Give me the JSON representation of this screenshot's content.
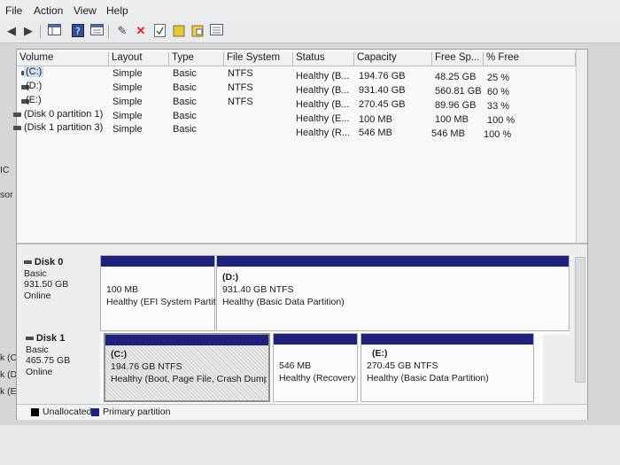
{
  "menu": [
    "File",
    "Action",
    "View",
    "Help"
  ],
  "columns": [
    "Volume",
    "Layout",
    "Type",
    "File System",
    "Status",
    "Capacity",
    "Free Sp...",
    "% Free"
  ],
  "volumes": [
    {
      "volume": "(C:)",
      "layout": "Simple",
      "type": "Basic",
      "fs": "NTFS",
      "status": "Healthy (B...",
      "capacity": "194.76 GB",
      "free": "48.25 GB",
      "pct": "25 %"
    },
    {
      "volume": "(D:)",
      "layout": "Simple",
      "type": "Basic",
      "fs": "NTFS",
      "status": "Healthy (B...",
      "capacity": "931.40 GB",
      "free": "560.81 GB",
      "pct": "60 %"
    },
    {
      "volume": "(E:)",
      "layout": "Simple",
      "type": "Basic",
      "fs": "NTFS",
      "status": "Healthy (B...",
      "capacity": "270.45 GB",
      "free": "89.96 GB",
      "pct": "33 %"
    },
    {
      "volume": "(Disk 0 partition 1)",
      "layout": "Simple",
      "type": "Basic",
      "fs": "",
      "status": "Healthy (E...",
      "capacity": "100 MB",
      "free": "100 MB",
      "pct": "100 %"
    },
    {
      "volume": "(Disk 1 partition 3)",
      "layout": "Simple",
      "type": "Basic",
      "fs": "",
      "status": "Healthy (R...",
      "capacity": "546 MB",
      "free": "546 MB",
      "pct": "100 %"
    }
  ],
  "disks": [
    {
      "name": "Disk 0",
      "type": "Basic",
      "size": "931.50 GB",
      "state": "Online",
      "partitions": [
        {
          "title": "",
          "size": "100 MB",
          "status": "Healthy (EFI System Partiti"
        },
        {
          "title": "(D:)",
          "size": "931.40 GB NTFS",
          "status": "Healthy (Basic Data Partition)"
        }
      ]
    },
    {
      "name": "Disk 1",
      "type": "Basic",
      "size": "465.75 GB",
      "state": "Online",
      "partitions": [
        {
          "title": "(C:)",
          "size": "194.76 GB NTFS",
          "status": "Healthy (Boot, Page File, Crash Dump, Ba"
        },
        {
          "title": "",
          "size": "546 MB",
          "status": "Healthy (Recovery P"
        },
        {
          "title": "(E:)",
          "size": "270.45 GB NTFS",
          "status": "Healthy (Basic Data Partition)"
        }
      ]
    }
  ],
  "legend": {
    "unallocated": "Unallocated",
    "primary": "Primary partition"
  },
  "side_labels": [
    "IC",
    "sor",
    "k (C:)",
    "k (D:)",
    "k (E:)"
  ],
  "colors": {
    "primary": "#1f217a",
    "unallocated": "#000000"
  }
}
